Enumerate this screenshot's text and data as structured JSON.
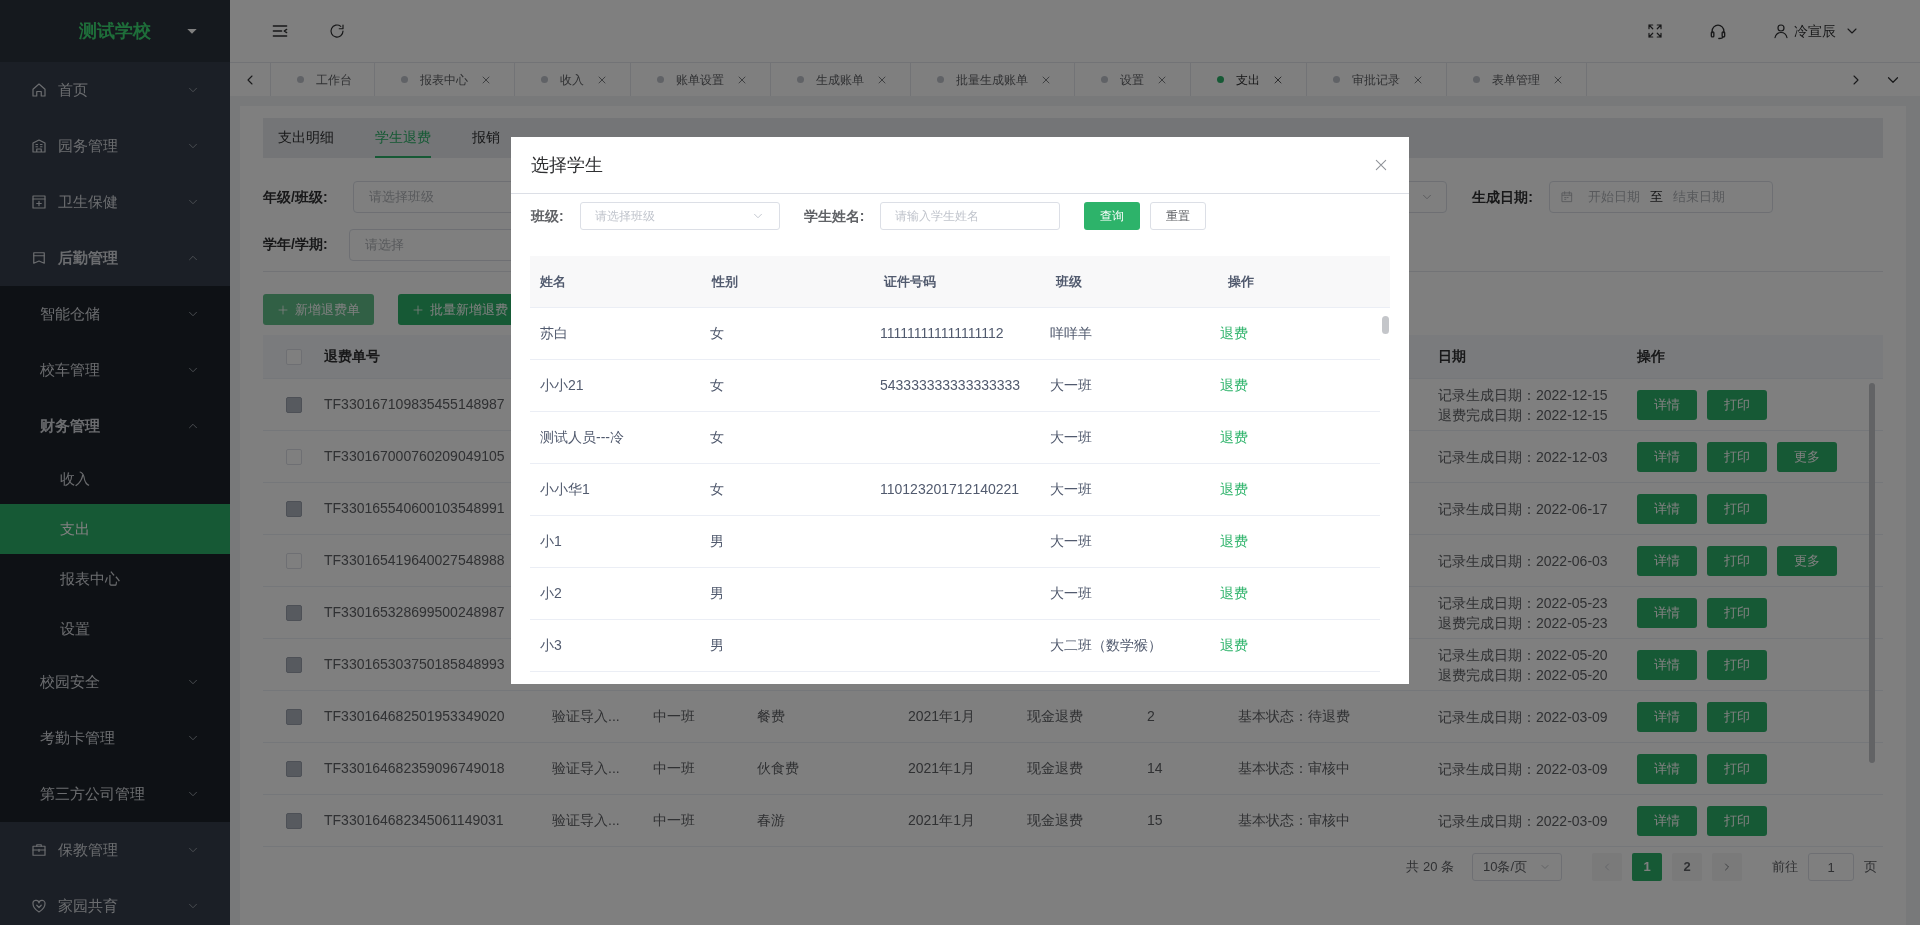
{
  "sidebar": {
    "logo": "测试学校",
    "items": [
      {
        "label": "首页",
        "expanded": false,
        "selected": false
      },
      {
        "label": "园务管理",
        "expanded": false,
        "selected": false
      },
      {
        "label": "卫生保健",
        "expanded": false,
        "selected": false
      },
      {
        "label": "后勤管理",
        "expanded": true,
        "selected": false,
        "children": [
          {
            "label": "智能仓储",
            "expanded": false,
            "selected": false
          },
          {
            "label": "校车管理",
            "expanded": false,
            "selected": false
          },
          {
            "label": "财务管理",
            "expanded": true,
            "selected": false,
            "children": [
              {
                "label": "收入",
                "selected": false
              },
              {
                "label": "支出",
                "selected": true
              },
              {
                "label": "报表中心",
                "selected": false
              },
              {
                "label": "设置",
                "selected": false
              }
            ]
          },
          {
            "label": "校园安全",
            "expanded": false,
            "selected": false
          },
          {
            "label": "考勤卡管理",
            "expanded": false,
            "selected": false
          },
          {
            "label": "第三方公司管理",
            "expanded": false,
            "selected": false
          }
        ]
      },
      {
        "label": "保教管理",
        "expanded": false,
        "selected": false
      },
      {
        "label": "家园共育",
        "expanded": false,
        "selected": false
      }
    ]
  },
  "header": {
    "user": "冷宣辰"
  },
  "tabs": [
    {
      "label": "工作台",
      "closable": false,
      "selected": false
    },
    {
      "label": "报表中心",
      "closable": true,
      "selected": false
    },
    {
      "label": "收入",
      "closable": true,
      "selected": false
    },
    {
      "label": "账单设置",
      "closable": true,
      "selected": false
    },
    {
      "label": "生成账单",
      "closable": true,
      "selected": false
    },
    {
      "label": "批量生成账单",
      "closable": true,
      "selected": false
    },
    {
      "label": "设置",
      "closable": true,
      "selected": false
    },
    {
      "label": "支出",
      "closable": true,
      "selected": true
    },
    {
      "label": "审批记录",
      "closable": true,
      "selected": false
    },
    {
      "label": "表单管理",
      "closable": true,
      "selected": false
    }
  ],
  "subtabs": [
    {
      "label": "支出明细",
      "selected": false
    },
    {
      "label": "学生退费",
      "selected": true
    },
    {
      "label": "报销",
      "selected": false
    }
  ],
  "filters": {
    "grade_label": "年级/班级:",
    "grade_placeholder": "请选择班级",
    "date_label": "生成日期:",
    "date_start": "开始日期",
    "date_separator": "至",
    "date_end": "结束日期",
    "term_label": "学年/学期:",
    "term_placeholder": "请选择"
  },
  "actions": [
    "新增退费单",
    "批量新增退费"
  ],
  "table": {
    "select_all": {
      "checked": false
    },
    "columns": {
      "number": "退费单号",
      "date": "日期",
      "actions": "操作"
    },
    "rows": [
      {
        "disabled": true,
        "number": "TF330167109835455148987",
        "dates": [
          "记录生成日期：2022-12-15",
          "退费完成日期：2022-12-15"
        ],
        "actions": [
          "详情",
          "打印"
        ]
      },
      {
        "disabled": false,
        "number": "TF330167000760209049105",
        "dates": [
          "记录生成日期：2022-12-03"
        ],
        "actions": [
          "详情",
          "打印",
          "更多"
        ]
      },
      {
        "disabled": true,
        "number": "TF330165540600103548991",
        "dates": [
          "记录生成日期：2022-06-17"
        ],
        "actions": [
          "详情",
          "打印"
        ]
      },
      {
        "disabled": false,
        "number": "TF330165419640027548988",
        "dates": [
          "记录生成日期：2022-06-03"
        ],
        "actions": [
          "详情",
          "打印",
          "更多"
        ]
      },
      {
        "disabled": true,
        "number": "TF330165328699500248987",
        "dates": [
          "记录生成日期：2022-05-23",
          "退费完成日期：2022-05-23"
        ],
        "actions": [
          "详情",
          "打印"
        ]
      },
      {
        "disabled": true,
        "number": "TF330165303750185848993",
        "dates": [
          "记录生成日期：2022-05-20",
          "退费完成日期：2022-05-20"
        ],
        "actions": [
          "详情",
          "打印"
        ]
      },
      {
        "disabled": true,
        "number": "TF330164682501953349020",
        "column_2": "验证导入...",
        "column_3": "中一班",
        "column_4": "餐费",
        "column_5": "2021年1月",
        "column_6": "现金退费",
        "column_7": "2",
        "column_8": "基本状态：待退费",
        "dates": [
          "记录生成日期：2022-03-09"
        ],
        "actions": [
          "详情",
          "打印"
        ]
      },
      {
        "disabled": true,
        "number": "TF330164682359096749018",
        "column_2": "验证导入...",
        "column_3": "中一班",
        "column_4": "伙食费",
        "column_5": "2021年1月",
        "column_6": "现金退费",
        "column_7": "14",
        "column_8": "基本状态：审核中",
        "dates": [
          "记录生成日期：2022-03-09"
        ],
        "actions": [
          "详情",
          "打印"
        ]
      },
      {
        "disabled": true,
        "number": "TF330164682345061149031",
        "column_2": "验证导入...",
        "column_3": "中一班",
        "column_4": "春游",
        "column_5": "2021年1月",
        "column_6": "现金退费",
        "column_7": "15",
        "column_8": "基本状态：审核中",
        "dates": [
          "记录生成日期：2022-03-09"
        ],
        "actions": [
          "详情",
          "打印"
        ]
      }
    ]
  },
  "pagination": {
    "total": "共 20 条",
    "page_size": "10条/页",
    "pages": [
      {
        "label": "1",
        "selected": true
      },
      {
        "label": "2",
        "selected": false
      }
    ],
    "goto_label": "前往",
    "goto_value": "1",
    "goto_suffix": "页"
  },
  "modal": {
    "title": "选择学生",
    "class_label": "班级:",
    "class_placeholder": "请选择班级",
    "name_label": "学生姓名:",
    "name_placeholder": "请输入学生姓名",
    "search_button": "查询",
    "reset_button": "重置",
    "columns": [
      "姓名",
      "性别",
      "证件号码",
      "班级",
      "操作"
    ],
    "rows": [
      {
        "name": "苏白",
        "gender": "女",
        "id_number": "111111111111111112",
        "class": "咩咩羊",
        "action": "退费"
      },
      {
        "name": "小小21",
        "gender": "女",
        "id_number": "543333333333333333",
        "class": "大一班",
        "action": "退费"
      },
      {
        "name": "测试人员---冷",
        "gender": "女",
        "class": "大一班",
        "action": "退费"
      },
      {
        "name": "小小华1",
        "gender": "女",
        "id_number": "110123201712140221",
        "class": "大一班",
        "action": "退费"
      },
      {
        "name": "小1",
        "gender": "男",
        "class": "大一班",
        "action": "退费"
      },
      {
        "name": "小2",
        "gender": "男",
        "class": "大一班",
        "action": "退费"
      },
      {
        "name": "小3",
        "gender": "男",
        "class": "大二班（数学猴）",
        "action": "退费"
      }
    ]
  }
}
